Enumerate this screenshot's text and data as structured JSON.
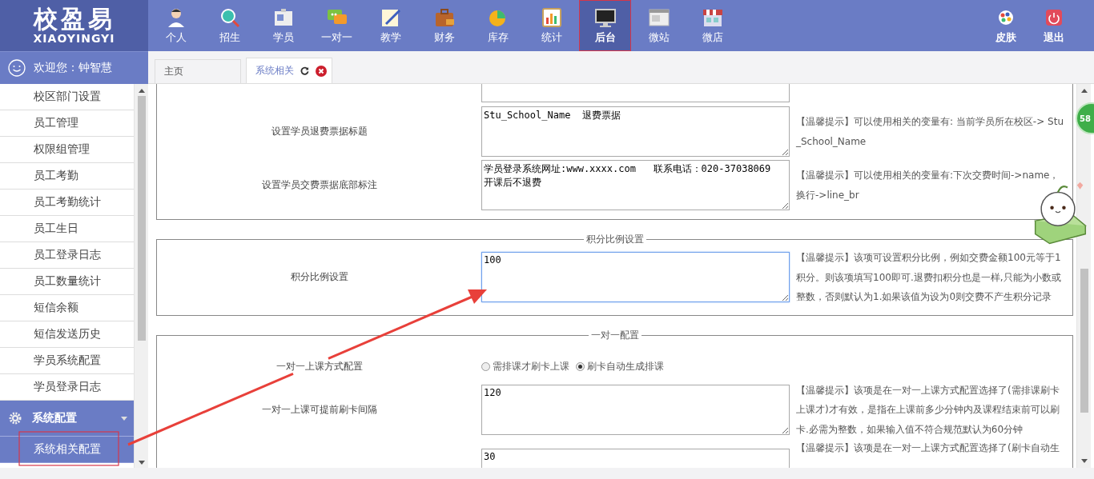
{
  "header": {
    "logo": {
      "title": "校盈易",
      "subtitle": "XIAOYINGYI"
    },
    "nav": [
      {
        "label": "个人",
        "selected": false
      },
      {
        "label": "招生",
        "selected": false
      },
      {
        "label": "学员",
        "selected": false
      },
      {
        "label": "一对一",
        "selected": false
      },
      {
        "label": "教学",
        "selected": false
      },
      {
        "label": "财务",
        "selected": false
      },
      {
        "label": "库存",
        "selected": false
      },
      {
        "label": "统计",
        "selected": false
      },
      {
        "label": "后台",
        "selected": true
      },
      {
        "label": "微站",
        "selected": false
      },
      {
        "label": "微店",
        "selected": false
      }
    ],
    "actions": [
      {
        "label": "皮肤"
      },
      {
        "label": "退出"
      }
    ]
  },
  "welcome": "欢迎您：钟智慧",
  "sidebar": {
    "items": [
      {
        "label": "校区部门设置",
        "selected": false
      },
      {
        "label": "员工管理",
        "selected": false
      },
      {
        "label": "权限组管理",
        "selected": false
      },
      {
        "label": "员工考勤",
        "selected": false
      },
      {
        "label": "员工考勤统计",
        "selected": false
      },
      {
        "label": "员工生日",
        "selected": false
      },
      {
        "label": "员工登录日志",
        "selected": false
      },
      {
        "label": "员工数量统计",
        "selected": false
      },
      {
        "label": "短信余额",
        "selected": false
      },
      {
        "label": "短信发送历史",
        "selected": false
      },
      {
        "label": "学员系统配置",
        "selected": false
      },
      {
        "label": "学员登录日志",
        "selected": false
      }
    ],
    "group": {
      "label": "系统配置",
      "expanded": true,
      "children": [
        {
          "label": "系统相关配置",
          "selected": true
        }
      ]
    }
  },
  "tabs": [
    {
      "label": "主页",
      "selected": false
    },
    {
      "label": "系统相关",
      "selected": true
    }
  ],
  "sections": [
    {
      "rows": [
        {
          "kind": "textarea",
          "label": "设置学员退费票据标题",
          "value": "Stu_School_Name  退费票据",
          "focused": false,
          "hint": "【温馨提示】可以使用相关的变量有: 当前学员所在校区-> Stu_School_Name"
        },
        {
          "kind": "textarea",
          "label": "设置学员交费票据底部标注",
          "value": "学员登录系统网址:www.xxxx.com   联系电话：020-37038069\n开课后不退费",
          "focused": false,
          "hint": "【温馨提示】可以使用相关的变量有:下次交费时间->name，换行->line_br"
        }
      ]
    },
    {
      "legend": "积分比例设置",
      "rows": [
        {
          "kind": "textarea",
          "label": "积分比例设置",
          "value": "100",
          "focused": true,
          "hint": "【温馨提示】该项可设置积分比例，例如交费金额100元等于1积分。则该项填写100即可.退费扣积分也是一样,只能为小数或整数，否则默认为1.如果该值为设为0则交费不产生积分记录"
        }
      ]
    },
    {
      "legend": "一对一配置",
      "rows": [
        {
          "kind": "radio",
          "label": "一对一上课方式配置",
          "options": [
            {
              "label": "需排课才刷卡上课",
              "selected": false
            },
            {
              "label": "刷卡自动生成排课",
              "selected": true
            }
          ]
        },
        {
          "kind": "textarea",
          "label": "一对一上课可提前刷卡间隔",
          "value": "120",
          "focused": false,
          "hint": "【温馨提示】该项是在一对一上课方式配置选择了(需排课刷卡上课才)才有效，是指在上课前多少分钟内及课程结束前可以刷卡.必需为整数，如果输入值不符合规范默认为60分钟"
        },
        {
          "kind": "textarea",
          "value": "30",
          "focused": false,
          "hint": "【温馨提示】该项是在一对一上课方式配置选择了(刷卡自动生"
        }
      ]
    }
  ],
  "badge": "58"
}
